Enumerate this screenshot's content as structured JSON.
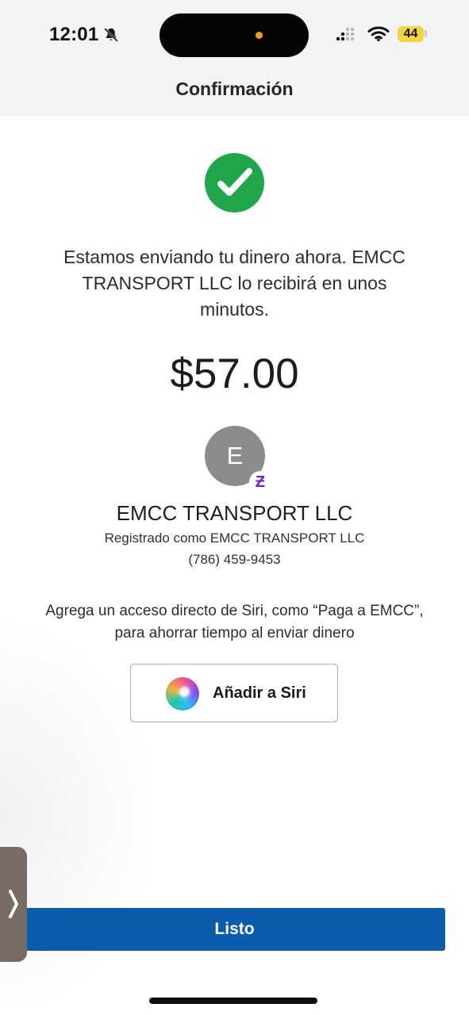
{
  "status_bar": {
    "time": "12:01",
    "battery": "44",
    "icons": [
      "muted-bell-icon",
      "signal-icon",
      "wifi-icon",
      "battery-icon"
    ]
  },
  "header": {
    "title": "Confirmación"
  },
  "confirmation": {
    "icon": "checkmark-icon",
    "message": "Estamos enviando tu dinero ahora. EMCC TRANSPORT LLC lo recibirá en unos minutos.",
    "amount": "$57.00"
  },
  "recipient": {
    "avatar_letter": "E",
    "badge_symbol": "Ƶ",
    "name": "EMCC TRANSPORT LLC",
    "registered_as": "Registrado como EMCC TRANSPORT LLC",
    "phone": "(786) 459-9453"
  },
  "siri": {
    "prompt": "Agrega un acceso directo de Siri, como “Paga a EMCC”, para ahorrar tiempo al enviar dinero",
    "button_label": "Añadir a Siri",
    "icon": "siri-icon"
  },
  "footer": {
    "done_label": "Listo"
  },
  "colors": {
    "primary_blue": "#0b5cad",
    "success_green": "#22a64b",
    "zelle_purple": "#6d1ed4",
    "header_gray": "#f2f3f5"
  }
}
